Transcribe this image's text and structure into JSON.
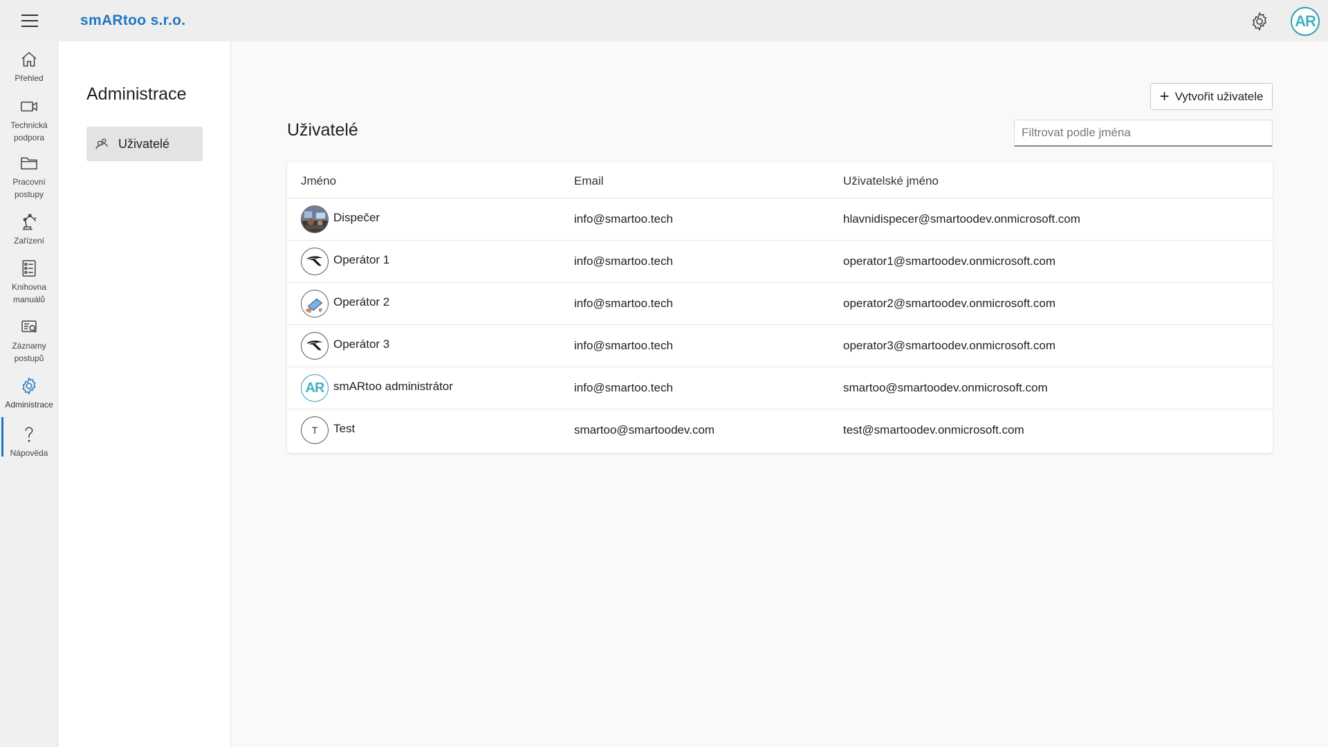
{
  "app": {
    "brand": "smARtoo s.r.o.",
    "accent_color": "#1f77c4",
    "avatar_initials": "AR"
  },
  "rail": [
    {
      "label": "Přehled",
      "icon": "home-icon"
    },
    {
      "label": "Technická podpora",
      "icon": "video-camera-icon"
    },
    {
      "label": "Pracovní postupy",
      "icon": "folder-icon"
    },
    {
      "label": "Zařízení",
      "icon": "robot-arm-icon"
    },
    {
      "label": "Knihovna manuálů",
      "icon": "manual-list-icon"
    },
    {
      "label": "Záznamy postupů",
      "icon": "records-icon"
    },
    {
      "label": "Administrace",
      "icon": "gear-icon",
      "active": true
    },
    {
      "label": "Nápověda",
      "icon": "question-icon"
    }
  ],
  "subnav": {
    "title": "Administrace",
    "items": [
      {
        "label": "Uživatelé",
        "icon": "users-icon"
      }
    ]
  },
  "main": {
    "title": "Uživatelé",
    "create_button": "Vytvořit uživatele",
    "filter_placeholder": "Filtrovat podle jména",
    "table": {
      "headers": [
        "Jméno",
        "Email",
        "Uživatelské jméno"
      ],
      "rows": [
        {
          "name": "Dispečer",
          "email": "info@smartoo.tech",
          "username": "hlavnidispecer@smartoodev.onmicrosoft.com",
          "avatar": "photo-avatar"
        },
        {
          "name": "Operátor 1",
          "email": "info@smartoo.tech",
          "username": "operator1@smartoodev.onmicrosoft.com",
          "avatar": "headset-avatar"
        },
        {
          "name": "Operátor 2",
          "email": "info@smartoo.tech",
          "username": "operator2@smartoodev.onmicrosoft.com",
          "avatar": "tablet-avatar"
        },
        {
          "name": "Operátor 3",
          "email": "info@smartoo.tech",
          "username": "operator3@smartoodev.onmicrosoft.com",
          "avatar": "headset-avatar"
        },
        {
          "name": "smARtoo administrátor",
          "email": "info@smartoo.tech",
          "username": "smartoo@smartoodev.onmicrosoft.com",
          "avatar": "ar-logo-avatar"
        },
        {
          "name": "Test",
          "email": "smartoo@smartoodev.com",
          "username": "test@smartoodev.onmicrosoft.com",
          "avatar": "initial-avatar",
          "initial": "T"
        }
      ]
    }
  }
}
